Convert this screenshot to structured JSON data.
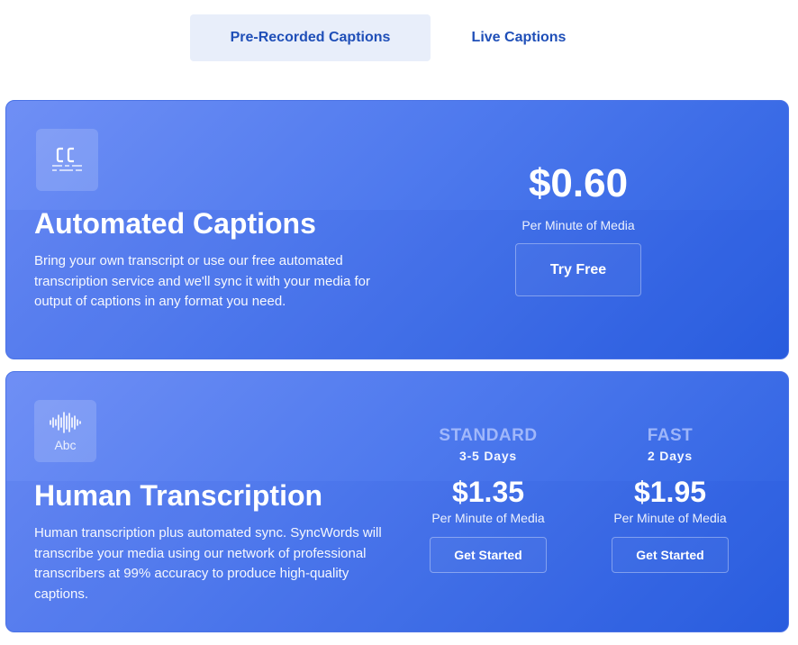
{
  "tabs": [
    {
      "label": "Pre-Recorded Captions",
      "active": true
    },
    {
      "label": "Live Captions",
      "active": false
    }
  ],
  "automated": {
    "icon": "closed-captions-icon",
    "title": "Automated Captions",
    "description": "Bring your own transcript or use our free automated transcription service and we'll sync it with your media for output of captions in any format you need.",
    "price": "$0.60",
    "price_unit": "Per Minute of Media",
    "button": "Try Free"
  },
  "human": {
    "icon": "soundwave-icon",
    "icon_text": "Abc",
    "title": "Human Transcription",
    "description": "Human transcription plus automated sync. SyncWords will transcribe your media using our network of professional transcribers at 99% accuracy to produce high-quality captions.",
    "tiers": [
      {
        "name": "STANDARD",
        "days": "3-5 Days",
        "price": "$1.35",
        "price_unit": "Per Minute of Media",
        "button": "Get Started"
      },
      {
        "name": "FAST",
        "days": "2 Days",
        "price": "$1.95",
        "price_unit": "Per Minute of Media",
        "button": "Get Started"
      }
    ]
  },
  "colors": {
    "tab_text": "#1f4fb8",
    "tab_active_bg": "#e8eefa",
    "card_gradient_start": "#6f8ff5",
    "card_gradient_end": "#2a5fe0"
  }
}
